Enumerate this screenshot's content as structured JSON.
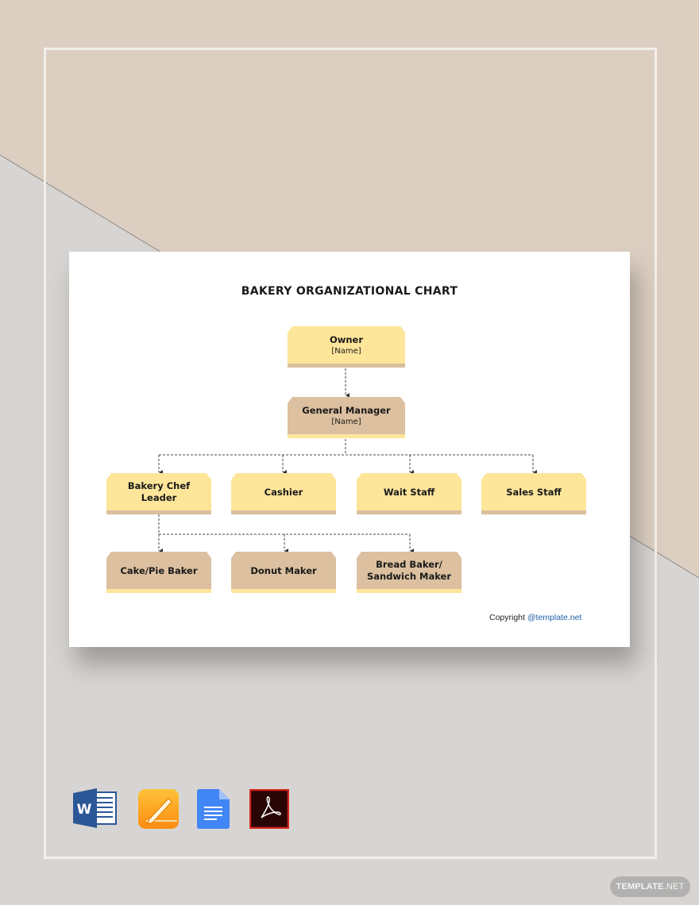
{
  "title": "BAKERY ORGANIZATIONAL CHART",
  "nodes": {
    "owner": {
      "label": "Owner",
      "sub": "[Name]"
    },
    "general_manager": {
      "label": "General Manager",
      "sub": "[Name]"
    },
    "bakery_chef_leader": {
      "label": "Bakery Chef Leader"
    },
    "cashier": {
      "label": "Cashier"
    },
    "wait_staff": {
      "label": "Wait Staff"
    },
    "sales_staff": {
      "label": "Sales Staff"
    },
    "cake_pie_baker": {
      "label": "Cake/Pie Baker"
    },
    "donut_maker": {
      "label": "Donut Maker"
    },
    "bread_baker": {
      "label": "Bread Baker/ Sandwich Maker"
    }
  },
  "hierarchy": {
    "owner": [
      "general_manager"
    ],
    "general_manager": [
      "bakery_chef_leader",
      "cashier",
      "wait_staff",
      "sales_staff"
    ],
    "bakery_chef_leader": [
      "cake_pie_baker",
      "donut_maker",
      "bread_baker"
    ]
  },
  "copyright": {
    "text": "Copyright",
    "link": "@template.net"
  },
  "formats": [
    {
      "name": "Microsoft Word",
      "icon": "word-icon"
    },
    {
      "name": "Apple Pages",
      "icon": "pages-icon"
    },
    {
      "name": "Google Docs",
      "icon": "google-docs-icon"
    },
    {
      "name": "Adobe PDF",
      "icon": "pdf-icon"
    }
  ],
  "brand": {
    "bold": "TEMPLATE",
    "thin": ".NET"
  },
  "colors": {
    "yellow_box": "#fde59a",
    "tan_box": "#dcc09f",
    "bg_top": "#dccfc2",
    "bg_bottom": "#d7d5d3",
    "link": "#1f5fa6"
  }
}
